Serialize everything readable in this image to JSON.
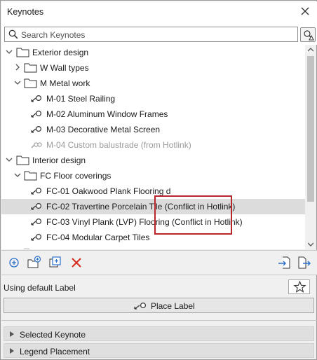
{
  "window": {
    "title": "Keynotes"
  },
  "search": {
    "placeholder": "Search Keynotes"
  },
  "tree": {
    "exterior": {
      "label": "Exterior design"
    },
    "wall_types": {
      "label": "W Wall types"
    },
    "metal_work": {
      "label": "M Metal work"
    },
    "m01": {
      "label": "M-01 Steel Railing"
    },
    "m02": {
      "label": "M-02 Aluminum Window Frames"
    },
    "m03": {
      "label": "M-03 Decorative Metal Screen"
    },
    "m04": {
      "label": "M-04 Custom balustrade (from Hotlink)"
    },
    "interior": {
      "label": "Interior design"
    },
    "floor_coverings": {
      "label": "FC Floor coverings"
    },
    "fc01": {
      "label": "FC-01 Oakwood Plank Flooring d"
    },
    "fc02": {
      "label": "FC-02 Travertine Porcelain Tile (Conflict in Hotlink)"
    },
    "fc03": {
      "label": "FC-03 Vinyl Plank (LVP) Flooring (Conflict in Hotlink)"
    },
    "fc04": {
      "label": "FC-04 Modular Carpet Tiles"
    }
  },
  "bottom": {
    "label_status": "Using default Label",
    "place_label": "Place Label",
    "selected_keynote": "Selected Keynote",
    "legend_placement": "Legend Placement"
  },
  "colors": {
    "highlight_border": "#b8262b",
    "selection_bg": "#dcdcdc",
    "add_icon": "#2a6fc9",
    "delete_icon": "#d92b1c"
  }
}
